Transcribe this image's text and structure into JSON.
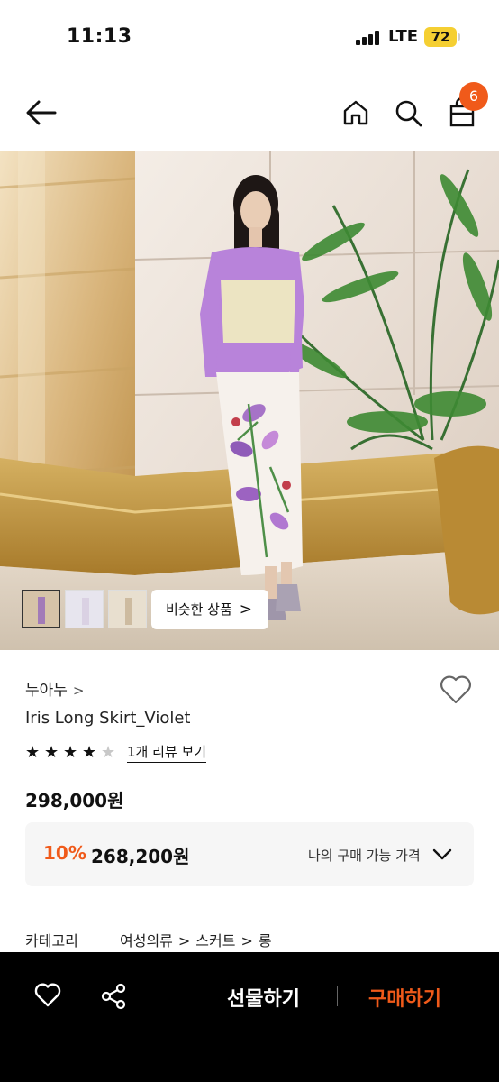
{
  "status": {
    "time": "11:13",
    "network": "LTE",
    "battery": "72"
  },
  "nav": {
    "cart_count": "6"
  },
  "hero": {
    "thumbnails": [
      "thumb-1",
      "thumb-2",
      "thumb-3"
    ],
    "similar_label": "비슷한 상품",
    "similar_chevron": ">"
  },
  "product": {
    "brand": "누아누",
    "brand_chevron": ">",
    "name": "Iris Long Skirt_Violet",
    "rating": 4,
    "review_link": "1개 리뷰 보기",
    "price": "298,000원",
    "discount_percent": "10%",
    "discount_price": "268,200원",
    "my_price_label": "나의 구매 가능 가격"
  },
  "category": {
    "label": "카테고리",
    "path": [
      "여성의류",
      "스커트",
      "롱"
    ]
  },
  "bottom_bar": {
    "gift_label": "선물하기",
    "buy_label": "구매하기"
  },
  "colors": {
    "accent": "#f05a1a",
    "bottom_bar_bg": "#000000",
    "battery": "#f5cf32"
  },
  "icons": [
    "back-arrow-icon",
    "home-icon",
    "search-icon",
    "cart-icon",
    "heart-icon",
    "share-icon",
    "chevron-down-icon",
    "star-icon"
  ]
}
